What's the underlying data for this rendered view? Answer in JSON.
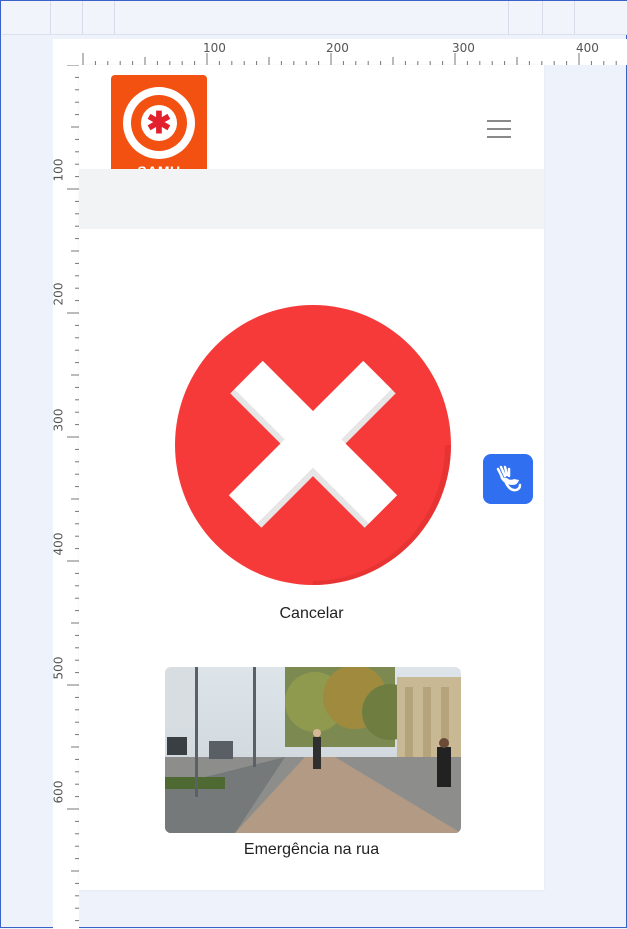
{
  "ruler": {
    "top_labels": [
      "100",
      "200",
      "300",
      "400"
    ],
    "left_labels": [
      "100",
      "200",
      "300",
      "400",
      "500",
      "600"
    ]
  },
  "header": {
    "logo_text": "SAMU",
    "menu_icon": "hamburger-icon"
  },
  "options": [
    {
      "label": "Cancelar",
      "icon": "cancel-x-icon",
      "color": "#f63a3a"
    },
    {
      "label": "Emergência na rua",
      "image": "street-photo"
    }
  ],
  "accessibility": {
    "icon": "sign-language-hands-icon",
    "color": "#2f6ff0"
  },
  "colors": {
    "brand": "#f35111",
    "accent": "#2f6ff0"
  }
}
